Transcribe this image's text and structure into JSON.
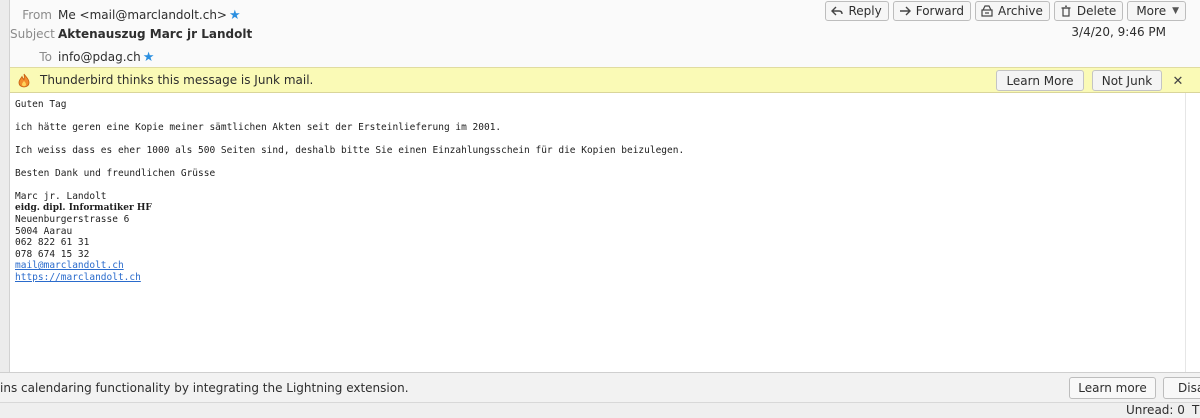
{
  "header": {
    "from_label": "From",
    "from_value": "Me <mail@marclandolt.ch>",
    "subject_label": "Subject",
    "subject_value": "Aktenauszug Marc jr Landolt",
    "to_label": "To",
    "to_value": "info@pdag.ch",
    "date": "3/4/20, 9:46 PM"
  },
  "toolbar": {
    "reply_label": "Reply",
    "forward_label": "Forward",
    "archive_label": "Archive",
    "delete_label": "Delete",
    "more_label": "More"
  },
  "junk_bar": {
    "message": "Thunderbird thinks this message is Junk mail.",
    "learn_more_label": "Learn More",
    "not_junk_label": "Not Junk",
    "close_symbol": "✕"
  },
  "message_body": {
    "greeting": "Guten Tag",
    "para1": "ich hätte geren eine Kopie meiner sämtlichen Akten seit der Ersteinlieferung im 2001.",
    "para2": "Ich weiss dass es eher 1000 als 500 Seiten sind, deshalb bitte Sie einen Einzahlungsschein für die Kopien beizulegen.",
    "closing": "Besten Dank und freundlichen Grüsse",
    "sig_name": "Marc jr. Landolt",
    "sig_title": "eidg. dipl. Informatiker HF",
    "sig_street": "Neuenburgerstrasse 6",
    "sig_city": "5004 Aarau",
    "sig_phone1": "062 822 61 31",
    "sig_phone2": "078 674 15 32",
    "sig_email": "mail@marclandolt.ch",
    "sig_web": "https://marclandolt.ch"
  },
  "notification": {
    "text": "ins calendaring functionality by integrating the Lightning extension.",
    "learn_more_label": "Learn more",
    "disable_label": "Disa"
  },
  "statusbar": {
    "unread": "Unread: 0",
    "total": "T"
  },
  "colors": {
    "star": "#2b8fe0",
    "junk_bar_bg": "#fafab6",
    "link": "#2a6bcc"
  },
  "icons": [
    "star-icon",
    "reply-icon",
    "forward-icon",
    "archive-icon",
    "delete-icon",
    "chevron-down-icon",
    "junk-fire-icon",
    "close-icon"
  ]
}
